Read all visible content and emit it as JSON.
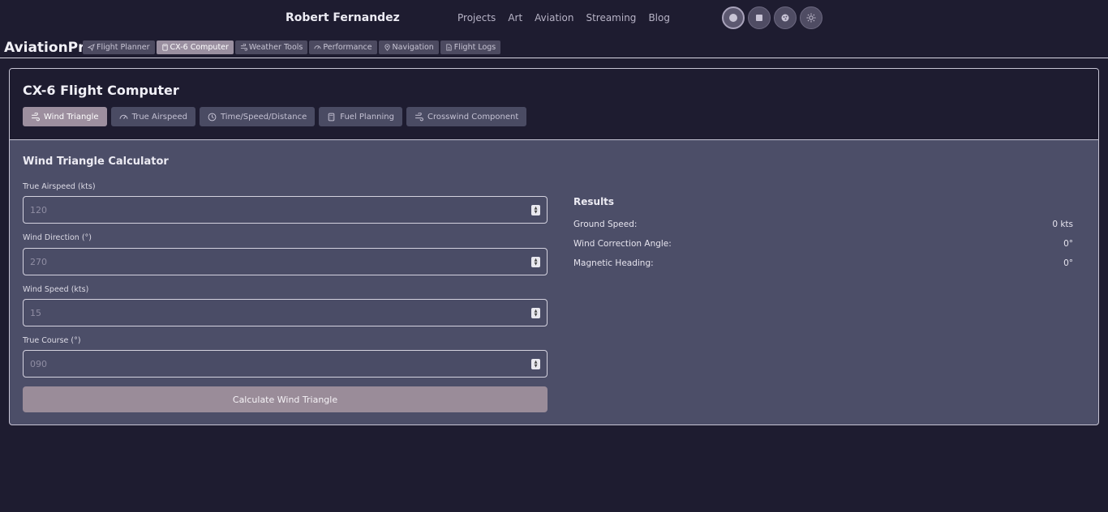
{
  "header": {
    "site_name": "Robert Fernandez",
    "nav": [
      "Projects",
      "Art",
      "Aviation",
      "Streaming",
      "Blog"
    ],
    "theme_buttons": [
      "circle-icon",
      "square-icon",
      "palette-icon",
      "sun-icon"
    ]
  },
  "app": {
    "brand": "AviationPro",
    "tabs": [
      {
        "label": "Flight Planner",
        "icon": "plane-icon"
      },
      {
        "label": "CX-6 Computer",
        "icon": "calculator-icon"
      },
      {
        "label": "Weather Tools",
        "icon": "wind-icon"
      },
      {
        "label": "Performance",
        "icon": "gauge-icon"
      },
      {
        "label": "Navigation",
        "icon": "map-pin-icon"
      },
      {
        "label": "Flight Logs",
        "icon": "document-icon"
      }
    ],
    "active_tab": "CX-6 Computer"
  },
  "computer": {
    "title": "CX-6 Flight Computer",
    "tabs": [
      {
        "label": "Wind Triangle",
        "icon": "wind-icon"
      },
      {
        "label": "True Airspeed",
        "icon": "gauge-icon"
      },
      {
        "label": "Time/Speed/Distance",
        "icon": "clock-icon"
      },
      {
        "label": "Fuel Planning",
        "icon": "calculator-icon"
      },
      {
        "label": "Crosswind Component",
        "icon": "wind-icon"
      }
    ],
    "active_tab": "Wind Triangle"
  },
  "calculator": {
    "title": "Wind Triangle Calculator",
    "fields": [
      {
        "label": "True Airspeed (kts)",
        "placeholder": "120",
        "value": ""
      },
      {
        "label": "Wind Direction (°)",
        "placeholder": "270",
        "value": ""
      },
      {
        "label": "Wind Speed (kts)",
        "placeholder": "15",
        "value": ""
      },
      {
        "label": "True Course (°)",
        "placeholder": "090",
        "value": ""
      }
    ],
    "button_label": "Calculate Wind Triangle"
  },
  "results": {
    "title": "Results",
    "rows": [
      {
        "label": "Ground Speed:",
        "value": "0 kts"
      },
      {
        "label": "Wind Correction Angle:",
        "value": "0°"
      },
      {
        "label": "Magnetic Heading:",
        "value": "0°"
      }
    ]
  },
  "colors": {
    "background": "#1e1c30",
    "panel": "#4c4e68",
    "accent": "#9a8c99"
  }
}
